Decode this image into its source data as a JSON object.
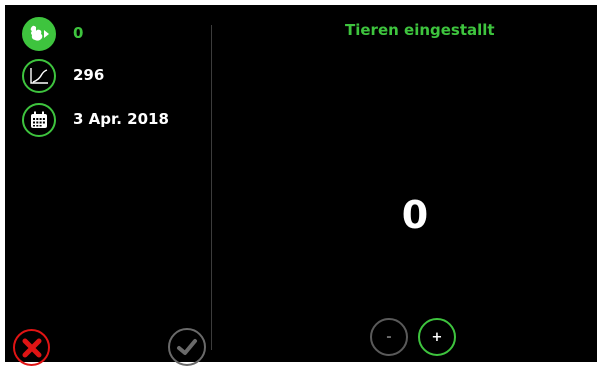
{
  "colors": {
    "accent": "#3ec43e",
    "danger": "#e01414",
    "disabled": "#6a6a6a",
    "background": "#000000",
    "text": "#ffffff"
  },
  "info": {
    "animals": {
      "icon": "chicken-icon",
      "value": "0"
    },
    "growth": {
      "icon": "growth-curve-icon",
      "value": "296"
    },
    "date": {
      "icon": "calendar-icon",
      "value": "3 Apr. 2018"
    }
  },
  "main": {
    "title": "Tieren eingestallt",
    "count": "0"
  },
  "stepper": {
    "minus_label": "-",
    "plus_label": "+"
  },
  "actions": {
    "cancel_icon": "close-icon",
    "confirm_icon": "checkmark-icon"
  }
}
